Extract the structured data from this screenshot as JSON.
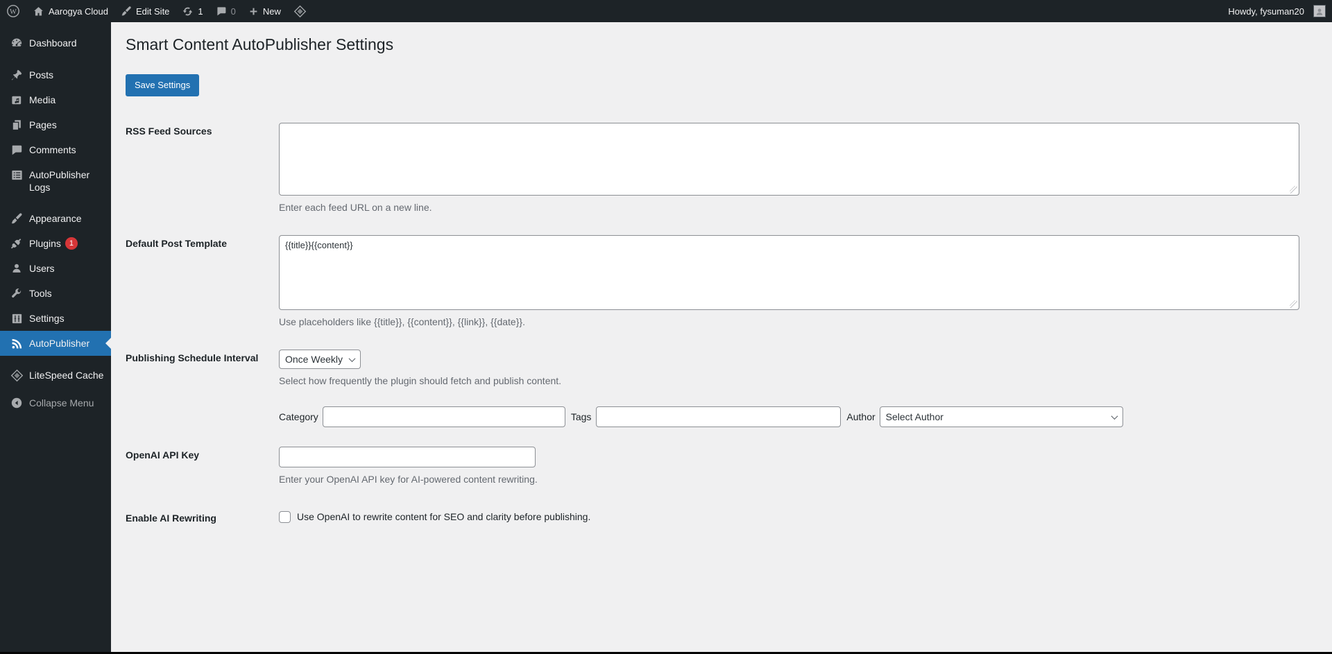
{
  "admin_bar": {
    "site_name": "Aarogya Cloud",
    "edit_site_label": "Edit Site",
    "updates_count": "1",
    "comments_count": "0",
    "new_label": "New",
    "howdy": "Howdy, fysuman20"
  },
  "sidebar": {
    "items": [
      {
        "label": "Dashboard"
      },
      {
        "label": "Posts"
      },
      {
        "label": "Media"
      },
      {
        "label": "Pages"
      },
      {
        "label": "Comments"
      },
      {
        "label": "AutoPublisher Logs"
      },
      {
        "label": "Appearance"
      },
      {
        "label": "Plugins",
        "badge": "1"
      },
      {
        "label": "Users"
      },
      {
        "label": "Tools"
      },
      {
        "label": "Settings"
      },
      {
        "label": "AutoPublisher",
        "active": true
      },
      {
        "label": "LiteSpeed Cache"
      },
      {
        "label": "Collapse Menu"
      }
    ]
  },
  "main": {
    "title": "Smart Content AutoPublisher Settings",
    "save_button": "Save Settings",
    "rows": {
      "rss": {
        "label": "RSS Feed Sources",
        "value": "",
        "help": "Enter each feed URL on a new line."
      },
      "template": {
        "label": "Default Post Template",
        "value": "{{title}}{{content}}",
        "help": "Use placeholders like {{title}}, {{content}}, {{link}}, {{date}}."
      },
      "interval": {
        "label": "Publishing Schedule Interval",
        "value": "Once Weekly",
        "help": "Select how frequently the plugin should fetch and publish content."
      },
      "taxonomy": {
        "category_label": "Category",
        "category_value": "",
        "tags_label": "Tags",
        "tags_value": "",
        "author_label": "Author",
        "author_value": "Select Author"
      },
      "api_key": {
        "label": "OpenAI API Key",
        "value": "",
        "help": "Enter your OpenAI API key for AI-powered content rewriting."
      },
      "ai_rewriting": {
        "label": "Enable AI Rewriting",
        "checked": false,
        "checkbox_label": "Use OpenAI to rewrite content for SEO and clarity before publishing."
      }
    }
  },
  "colors": {
    "accent": "#2271b1",
    "admin_bar_bg": "#1d2327",
    "menu_bg": "#1d2327",
    "content_bg": "#f0f0f1",
    "badge_red": "#d63638",
    "icon_gray": "#a7aaad",
    "help_text": "#646970",
    "input_border": "#8c8f94",
    "title_color": "#1d2327",
    "text_light": "#f0f0f1"
  }
}
